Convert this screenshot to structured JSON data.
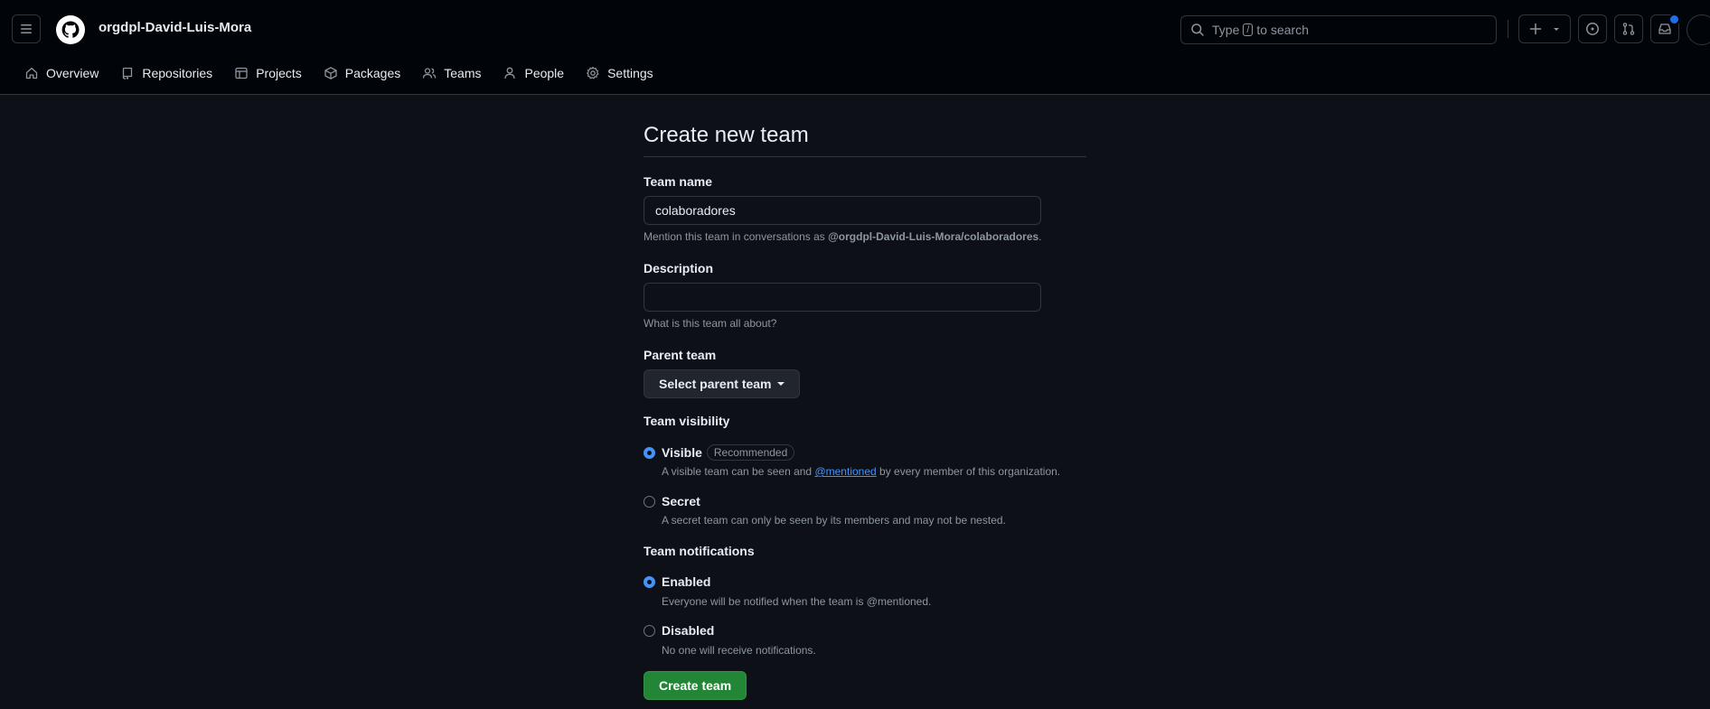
{
  "header": {
    "org_name": "orgdpl-David-Luis-Mora",
    "search": {
      "prefix": "Type",
      "key": "/",
      "suffix": "to search"
    }
  },
  "nav": {
    "tabs": [
      {
        "label": "Overview",
        "icon": "home-icon"
      },
      {
        "label": "Repositories",
        "icon": "repo-icon"
      },
      {
        "label": "Projects",
        "icon": "table-icon"
      },
      {
        "label": "Packages",
        "icon": "package-icon"
      },
      {
        "label": "Teams",
        "icon": "people-icon"
      },
      {
        "label": "People",
        "icon": "person-icon"
      },
      {
        "label": "Settings",
        "icon": "gear-icon"
      }
    ]
  },
  "form": {
    "title": "Create new team",
    "team_name": {
      "label": "Team name",
      "value": "colaboradores",
      "note_prefix": "Mention this team in conversations as",
      "note_mention": "@orgdpl-David-Luis-Mora/colaboradores",
      "note_suffix": "."
    },
    "description": {
      "label": "Description",
      "value": "",
      "note": "What is this team all about?"
    },
    "parent_team": {
      "label": "Parent team",
      "button": "Select parent team"
    },
    "visibility": {
      "label": "Team visibility",
      "visible": {
        "label": "Visible",
        "badge": "Recommended",
        "note_prefix": "A visible team can be seen and",
        "note_link": "@mentioned",
        "note_suffix": "by every member of this organization.",
        "checked": true
      },
      "secret": {
        "label": "Secret",
        "note": "A secret team can only be seen by its members and may not be nested.",
        "checked": false
      }
    },
    "notifications": {
      "label": "Team notifications",
      "enabled": {
        "label": "Enabled",
        "note": "Everyone will be notified when the team is @mentioned.",
        "checked": true
      },
      "disabled": {
        "label": "Disabled",
        "note": "No one will receive notifications.",
        "checked": false
      }
    },
    "submit": "Create team"
  },
  "colors": {
    "background": "#0d1117",
    "header": "#010409",
    "border": "#30363d",
    "primary_button": "#238636",
    "link": "#4493f8"
  }
}
